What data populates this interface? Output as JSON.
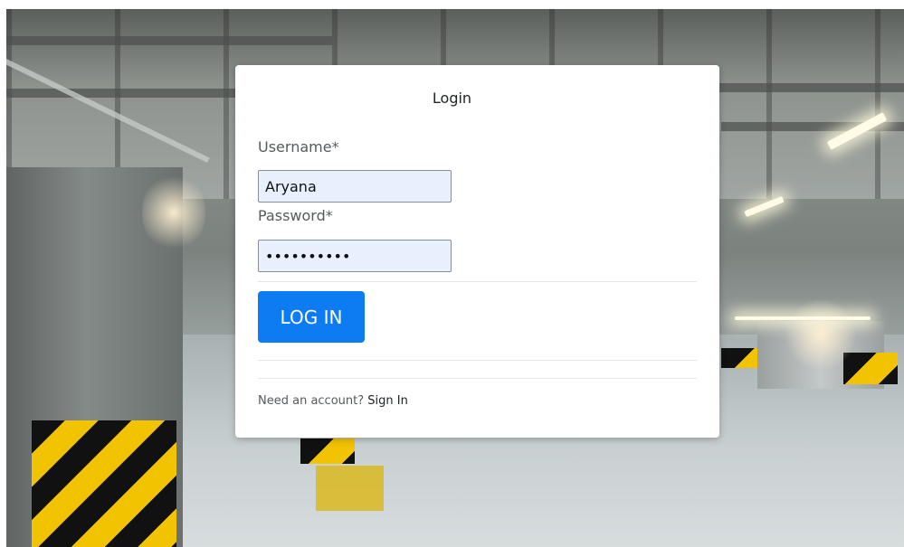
{
  "login": {
    "title": "Login",
    "username_label": "Username*",
    "username_value": "Aryana",
    "password_label": "Password*",
    "password_value": "Aryana2024",
    "submit_label": "LOG IN",
    "footer_text": "Need an account?",
    "signin_link": "Sign In"
  }
}
